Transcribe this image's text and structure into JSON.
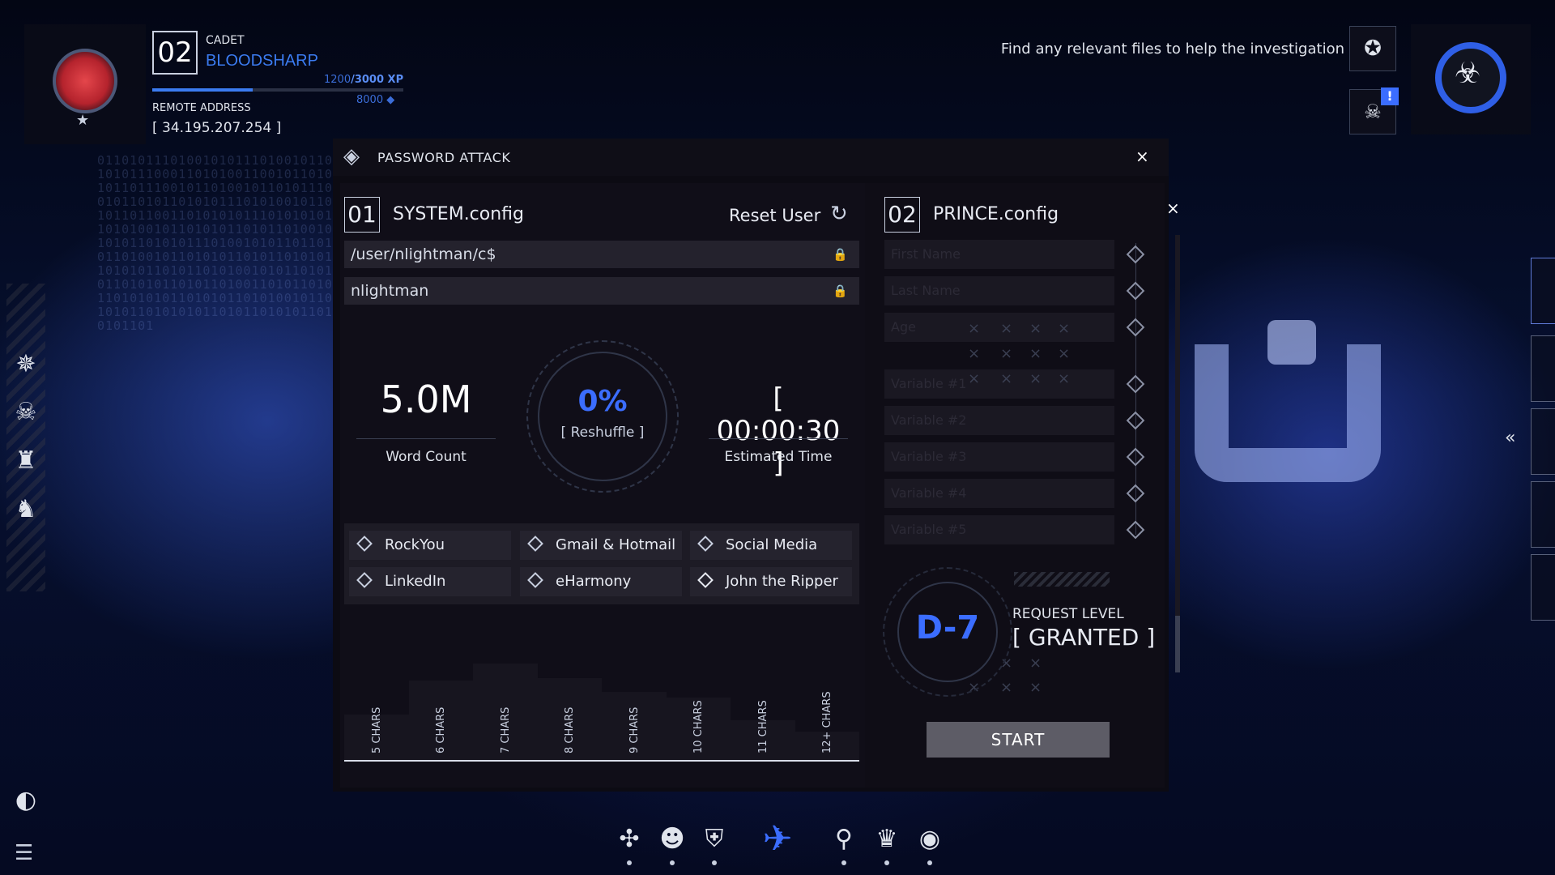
{
  "player": {
    "level": "02",
    "rank": "CADET",
    "name": "BLOODSHARP",
    "xp_current": "1200",
    "xp_max": "/3000 XP",
    "xp_progress": 0.4,
    "credits": "8000",
    "remote_label": "REMOTE ADDRESS",
    "remote_address": "[ 34.195.207.254 ]"
  },
  "objective": {
    "text": "Find any relevant files to help the investigation",
    "alert_badge": "!"
  },
  "window": {
    "title": "PASSWORD ATTACK",
    "close": "×"
  },
  "system_panel": {
    "number": "01",
    "title": "SYSTEM.config",
    "reset_label": "Reset User",
    "path_value": "/user/nlightman/c$",
    "user_value": "nlightman",
    "word_count": "5.0M",
    "word_count_label": "Word Count",
    "progress": "0%",
    "progress_sub": "[ Reshuffle ]",
    "estimated_time": "[ 00:00:30 ]",
    "estimated_label": "Estimated Time",
    "dictionaries": [
      {
        "label": "RockYou",
        "selected": false
      },
      {
        "label": "Gmail & Hotmail",
        "selected": false
      },
      {
        "label": "Social Media",
        "selected": false
      },
      {
        "label": "LinkedIn",
        "selected": false
      },
      {
        "label": "eHarmony",
        "selected": false
      },
      {
        "label": "John the Ripper",
        "selected": true
      }
    ],
    "histogram": {
      "labels": [
        "5 CHARS",
        "6 CHARS",
        "7 CHARS",
        "8 CHARS",
        "9 CHARS",
        "10 CHARS",
        "11 CHARS",
        "12+ CHARS"
      ],
      "levels": [
        0.4,
        0.7,
        0.85,
        0.72,
        0.6,
        0.55,
        0.35,
        0.25
      ]
    }
  },
  "prince_panel": {
    "number": "02",
    "title": "PRINCE.config",
    "close": "×",
    "fields": [
      "First Name",
      "Last Name",
      "Age",
      "Variable #1",
      "Variable #2",
      "Variable #3",
      "Variable #4",
      "Variable #5"
    ],
    "level_code": "D-7",
    "request_label": "REQUEST LEVEL",
    "request_value": "[ GRANTED ]",
    "start_label": "START"
  },
  "icons": {
    "left": [
      "compass-icon",
      "skull-icon",
      "chess-icon",
      "helmet-icon"
    ],
    "bottom": [
      "nodes-icon",
      "agent-icon",
      "shield-w-icon",
      "bird-emblem-icon",
      "map-pin-icon",
      "crown-icon",
      "eye-icon"
    ]
  },
  "colors": {
    "accent": "#3b6dff",
    "player_name": "#3b7bf0",
    "avatar": "#c7262f"
  }
}
